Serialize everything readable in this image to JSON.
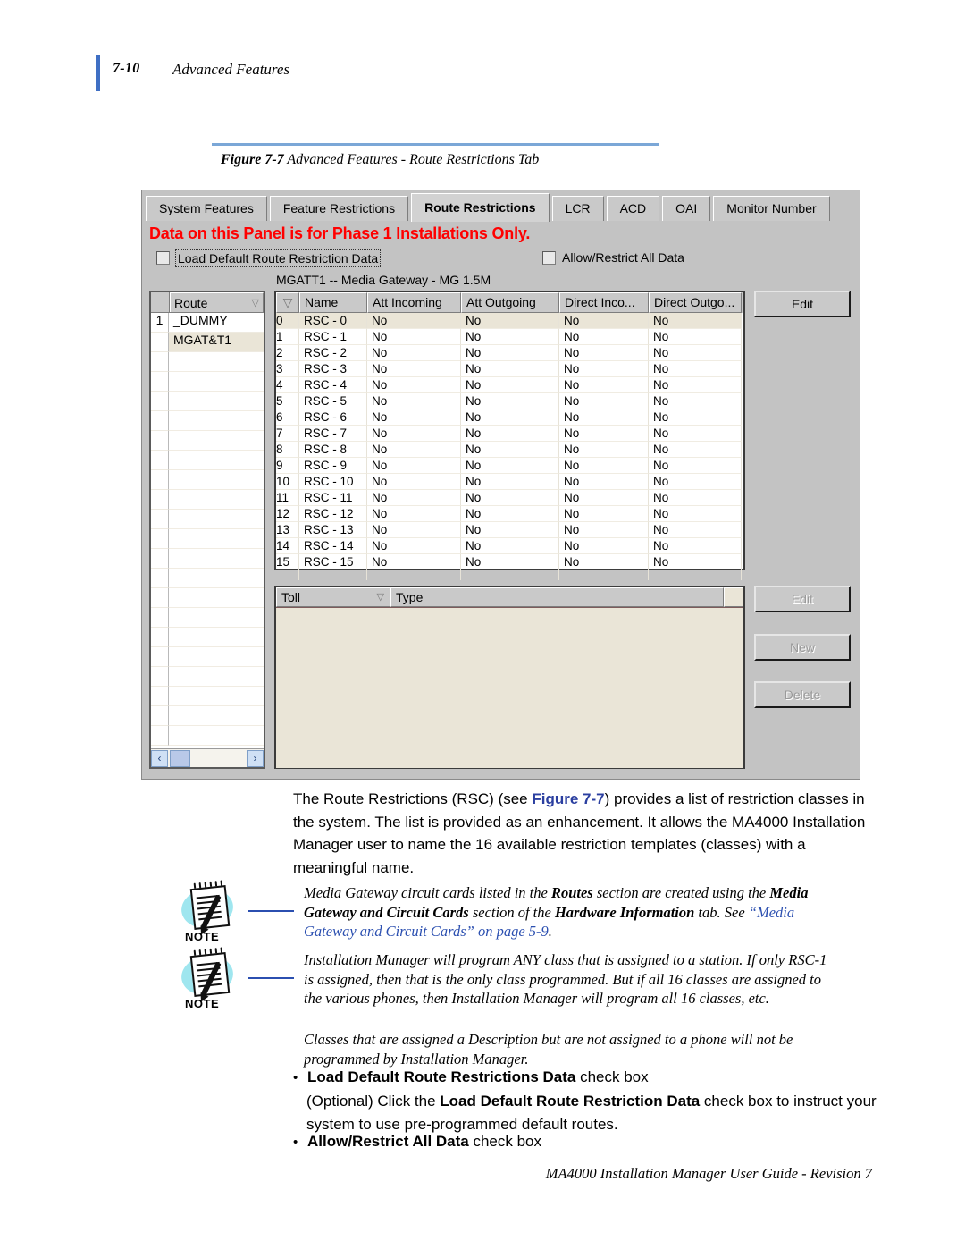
{
  "page": {
    "number": "7-10",
    "running_head": "Advanced Features",
    "footer": "MA4000 Installation Manager User Guide - Revision 7"
  },
  "figure": {
    "label": "Figure 7-7",
    "caption": "Advanced Features - Route Restrictions Tab"
  },
  "app": {
    "tabs": [
      {
        "label": "System Features",
        "active": false
      },
      {
        "label": "Feature Restrictions",
        "active": false
      },
      {
        "label": "Route Restrictions",
        "active": true
      },
      {
        "label": "LCR",
        "active": false
      },
      {
        "label": "ACD",
        "active": false
      },
      {
        "label": "OAI",
        "active": false
      },
      {
        "label": "Monitor Number",
        "active": false
      }
    ],
    "banner": "Data on this Panel is for Phase 1 Installations Only.",
    "banner_color": "#ff0000",
    "checkboxes": [
      {
        "label": "Load Default Route Restriction Data",
        "checked": false,
        "focused": true
      },
      {
        "label": "Allow/Restrict All Data",
        "checked": false,
        "focused": false
      }
    ],
    "gateway_title": "MGATT1 -- Media Gateway - MG 1.5M",
    "route_grid": {
      "header": "Route",
      "sort_glyph": "▽",
      "rows": [
        {
          "num": "1",
          "name": "_DUMMY",
          "selected": false
        },
        {
          "num": "",
          "name": "MGAT&T1",
          "selected": true
        }
      ],
      "blank_rows": 20
    },
    "rsc_grid": {
      "columns": [
        "",
        "Name",
        "Att Incoming",
        "Att Outgoing",
        "Direct Inco...",
        "Direct Outgo..."
      ],
      "sort_glyph": "▽",
      "rows": [
        {
          "idx": "0",
          "name": "RSC - 0",
          "att_in": "No",
          "att_out": "No",
          "dir_in": "No",
          "dir_out": "No",
          "selected": true
        },
        {
          "idx": "1",
          "name": "RSC - 1",
          "att_in": "No",
          "att_out": "No",
          "dir_in": "No",
          "dir_out": "No",
          "selected": false
        },
        {
          "idx": "2",
          "name": "RSC - 2",
          "att_in": "No",
          "att_out": "No",
          "dir_in": "No",
          "dir_out": "No",
          "selected": false
        },
        {
          "idx": "3",
          "name": "RSC - 3",
          "att_in": "No",
          "att_out": "No",
          "dir_in": "No",
          "dir_out": "No",
          "selected": false
        },
        {
          "idx": "4",
          "name": "RSC - 4",
          "att_in": "No",
          "att_out": "No",
          "dir_in": "No",
          "dir_out": "No",
          "selected": false
        },
        {
          "idx": "5",
          "name": "RSC - 5",
          "att_in": "No",
          "att_out": "No",
          "dir_in": "No",
          "dir_out": "No",
          "selected": false
        },
        {
          "idx": "6",
          "name": "RSC - 6",
          "att_in": "No",
          "att_out": "No",
          "dir_in": "No",
          "dir_out": "No",
          "selected": false
        },
        {
          "idx": "7",
          "name": "RSC - 7",
          "att_in": "No",
          "att_out": "No",
          "dir_in": "No",
          "dir_out": "No",
          "selected": false
        },
        {
          "idx": "8",
          "name": "RSC - 8",
          "att_in": "No",
          "att_out": "No",
          "dir_in": "No",
          "dir_out": "No",
          "selected": false
        },
        {
          "idx": "9",
          "name": "RSC - 9",
          "att_in": "No",
          "att_out": "No",
          "dir_in": "No",
          "dir_out": "No",
          "selected": false
        },
        {
          "idx": "10",
          "name": "RSC - 10",
          "att_in": "No",
          "att_out": "No",
          "dir_in": "No",
          "dir_out": "No",
          "selected": false
        },
        {
          "idx": "11",
          "name": "RSC - 11",
          "att_in": "No",
          "att_out": "No",
          "dir_in": "No",
          "dir_out": "No",
          "selected": false
        },
        {
          "idx": "12",
          "name": "RSC - 12",
          "att_in": "No",
          "att_out": "No",
          "dir_in": "No",
          "dir_out": "No",
          "selected": false
        },
        {
          "idx": "13",
          "name": "RSC - 13",
          "att_in": "No",
          "att_out": "No",
          "dir_in": "No",
          "dir_out": "No",
          "selected": false
        },
        {
          "idx": "14",
          "name": "RSC - 14",
          "att_in": "No",
          "att_out": "No",
          "dir_in": "No",
          "dir_out": "No",
          "selected": false
        },
        {
          "idx": "15",
          "name": "RSC - 15",
          "att_in": "No",
          "att_out": "No",
          "dir_in": "No",
          "dir_out": "No",
          "selected": false
        }
      ]
    },
    "toll_grid": {
      "columns": [
        "Toll",
        "Type"
      ],
      "sort_glyph": "▽",
      "rows": []
    },
    "buttons": [
      {
        "label": "Edit",
        "enabled": true
      },
      {
        "label": "Edit",
        "enabled": false
      },
      {
        "label": "New",
        "enabled": false
      },
      {
        "label": "Delete",
        "enabled": false
      }
    ],
    "scrollbar": {
      "left_arrow": "‹",
      "right_arrow": "›"
    }
  },
  "body": {
    "main_paragraph": {
      "pre": "The Route Restrictions (RSC) (see ",
      "xref": "Figure 7-7",
      "post": ") provides a list of restriction classes in the system. The list is provided as an enhancement. It allows the MA4000 Installation Manager user to name the 16 available restriction templates (classes) with a meaningful name."
    },
    "notes": [
      {
        "label": "NOTE",
        "segments": [
          {
            "text": "Media Gateway circuit cards listed in the ",
            "style": "italic"
          },
          {
            "text": "Routes",
            "style": "bold"
          },
          {
            "text": " section are created using the ",
            "style": "italic"
          },
          {
            "text": "Media Gateway and Circuit Cards",
            "style": "bold"
          },
          {
            "text": " section of the ",
            "style": "italic"
          },
          {
            "text": "Hardware Information",
            "style": "bold"
          },
          {
            "text": " tab. See ",
            "style": "italic"
          },
          {
            "text": "“Media Gateway and Circuit Cards” on page 5-9",
            "style": "link"
          },
          {
            "text": ".",
            "style": "italic"
          }
        ]
      },
      {
        "label": "NOTE",
        "segments": [
          {
            "text": "Installation Manager will program ANY class that is assigned to a station. If only RSC-1 is assigned, then that is the only class programmed. But if all 16 classes are assigned to the various phones, then Installation Manager will program all 16 classes, etc.",
            "style": "italic"
          }
        ]
      }
    ],
    "closing_note": "Classes that are assigned a Description but are not assigned to a phone will not be programmed by Installation Manager.",
    "bullets": [
      {
        "dot": "•",
        "bold": "Load Default Route Restrictions Data",
        "rest": " check box"
      },
      {
        "dot": "•",
        "bold": "Allow/Restrict All Data",
        "rest": " check box"
      }
    ],
    "optional_paragraph": {
      "pre": "(Optional) Click the ",
      "bold": "Load Default Route Restriction Data",
      "post": " check box to instruct your system to use pre-programmed default routes."
    }
  }
}
